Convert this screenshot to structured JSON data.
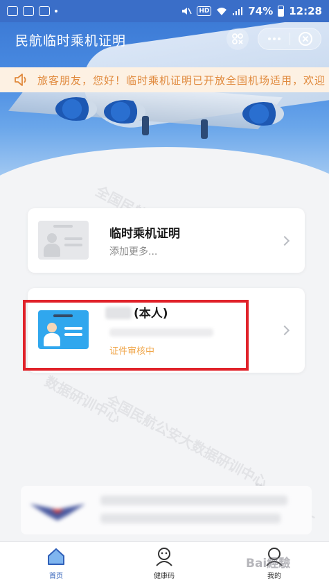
{
  "status_bar": {
    "battery_percent": "74%",
    "time": "12:28",
    "network_badge": "HD",
    "battery_level": 0.74
  },
  "header": {
    "title": "民航临时乘机证明",
    "scan_icon": "scan-qr-icon",
    "more_icon": "more-dots-icon",
    "close_icon": "close-circle-icon"
  },
  "notice": {
    "icon": "speaker-icon",
    "text": "旅客朋友，您好！临时乘机证明已开放全国机场适用，欢迎"
  },
  "cards": [
    {
      "title": "临时乘机证明",
      "subtitle": "添加更多..."
    },
    {
      "name_suffix": "(本人)",
      "status": "证件审核中"
    }
  ],
  "watermark": {
    "lines": [
      "全国民航公安大数据",
      "数据研训中心",
      "全国民航公安大数据研训中心",
      "民航公安大"
    ]
  },
  "tabbar": {
    "items": [
      {
        "label": "首页",
        "icon": "home-icon",
        "active": true
      },
      {
        "label": "健康码",
        "icon": "health-code-icon",
        "active": false
      },
      {
        "label": "我的",
        "icon": "profile-icon",
        "active": false
      }
    ]
  },
  "overlay": {
    "baidu_watermark": "Bai經驗"
  },
  "colors": {
    "brand_blue": "#3a6ec8",
    "notice_text": "#e0893c",
    "status_orange": "#f0a64a",
    "highlight_red": "#e0222a",
    "tab_active": "#2f5fb8"
  }
}
